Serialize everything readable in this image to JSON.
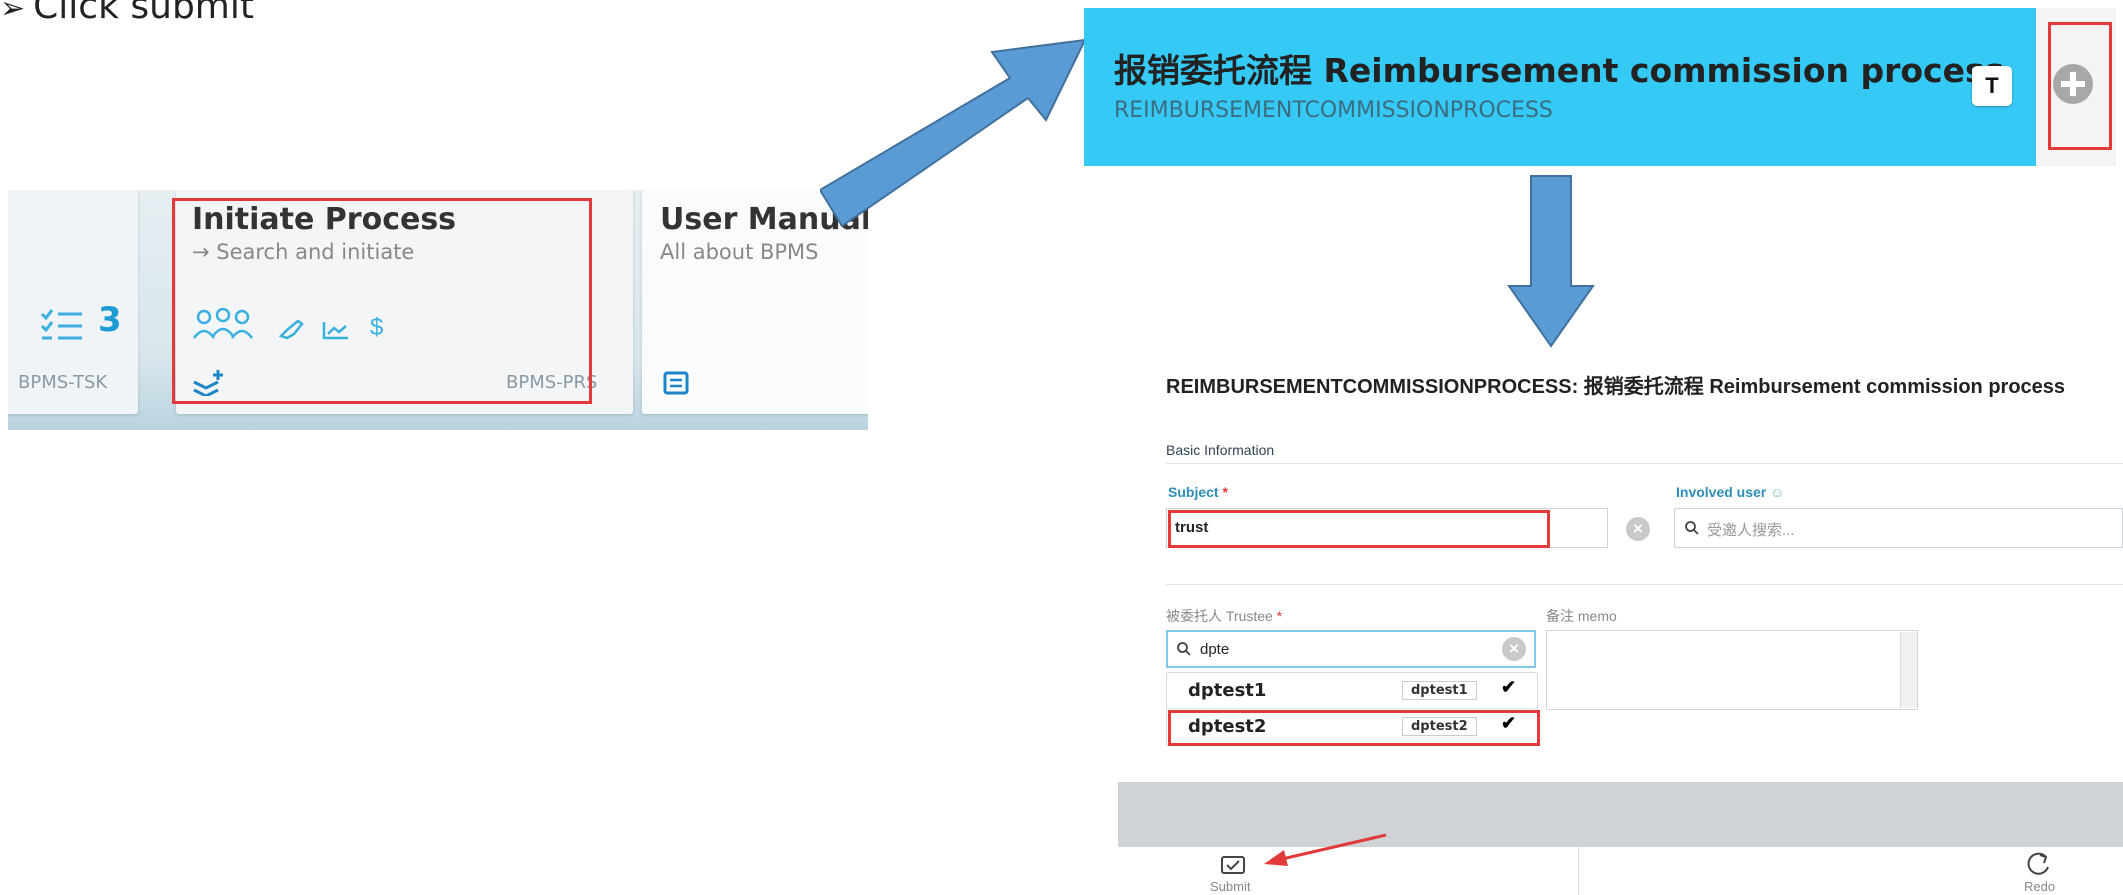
{
  "instruction": {
    "bullet": "➢",
    "text": "Click submit"
  },
  "dashboard": {
    "tasks": {
      "count": "3",
      "code": "BPMS-TSK"
    },
    "initiate": {
      "title": "Initiate Process",
      "subtitle": "→ Search and initiate",
      "code": "BPMS-PRS"
    },
    "manual": {
      "title": "User Manual",
      "subtitle": "All about BPMS"
    }
  },
  "banner": {
    "title": "报销委托流程 Reimbursement commission process",
    "subtitle": "REIMBURSEMENTCOMMISSIONPROCESS",
    "t_button": "T"
  },
  "form": {
    "title": "REIMBURSEMENTCOMMISSIONPROCESS: 报销委托流程 Reimbursement commission process",
    "section": "Basic Information",
    "subject": {
      "label": "Subject",
      "required": "*",
      "value": "trust"
    },
    "involved": {
      "label": "Involved user",
      "placeholder": "受邀人搜索..."
    },
    "trustee": {
      "label": "被委托人 Trustee",
      "required": "*",
      "search": "dpte"
    },
    "memo": {
      "label": "备注 memo"
    },
    "options": [
      {
        "name": "dptest1",
        "tag": "dptest1"
      },
      {
        "name": "dptest2",
        "tag": "dptest2"
      }
    ],
    "submit_label": "Submit",
    "redo_label": "Redo"
  },
  "colors": {
    "accent": "#35c9f5",
    "highlight": "#e23a3a",
    "arrow": "#5b9bd5"
  }
}
